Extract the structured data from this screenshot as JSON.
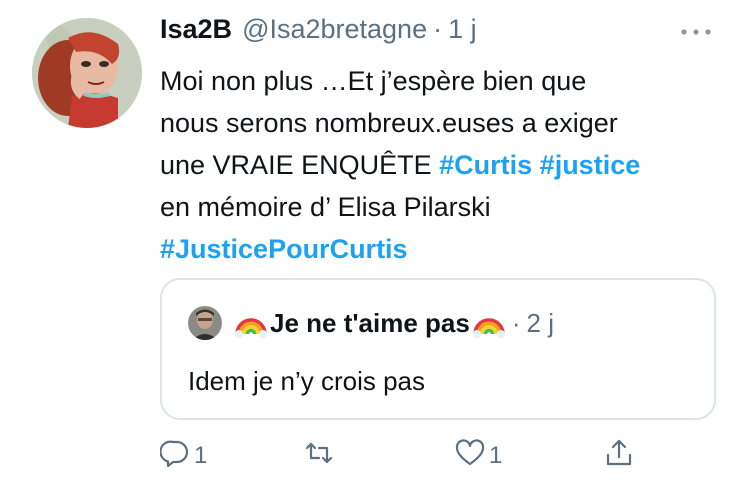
{
  "tweet": {
    "display_name": "Isa2B",
    "handle": "@Isa2bretagne",
    "separator": "·",
    "time": "1 j",
    "text_lines": [
      "Moi non plus …Et j’espère bien que",
      "nous serons nombreux.euses a exiger",
      "une VRAIE ENQUÊTE"
    ],
    "hashtag_curtis": "#Curtis",
    "hashtag_justice": "#justice",
    "text_line4": "en mémoire d’ Elisa Pilarski",
    "hashtag_justicepourcurtis": "#JusticePourCurtis"
  },
  "quote": {
    "name": "Je ne t'aime pas",
    "name_emoji": "rainbow-emoji",
    "separator": "·",
    "time": "2 j",
    "text": "Idem je n’y crois pas"
  },
  "actions": {
    "reply_count": "1",
    "retweet_count": "",
    "like_count": "1"
  },
  "icons": {
    "more": "more-dots-icon",
    "reply": "reply-icon",
    "retweet": "retweet-icon",
    "like": "heart-icon",
    "share": "share-icon"
  },
  "colors": {
    "hashtag": "#1da1f2",
    "secondary_text": "#5b7083",
    "border": "#dde3e8"
  }
}
